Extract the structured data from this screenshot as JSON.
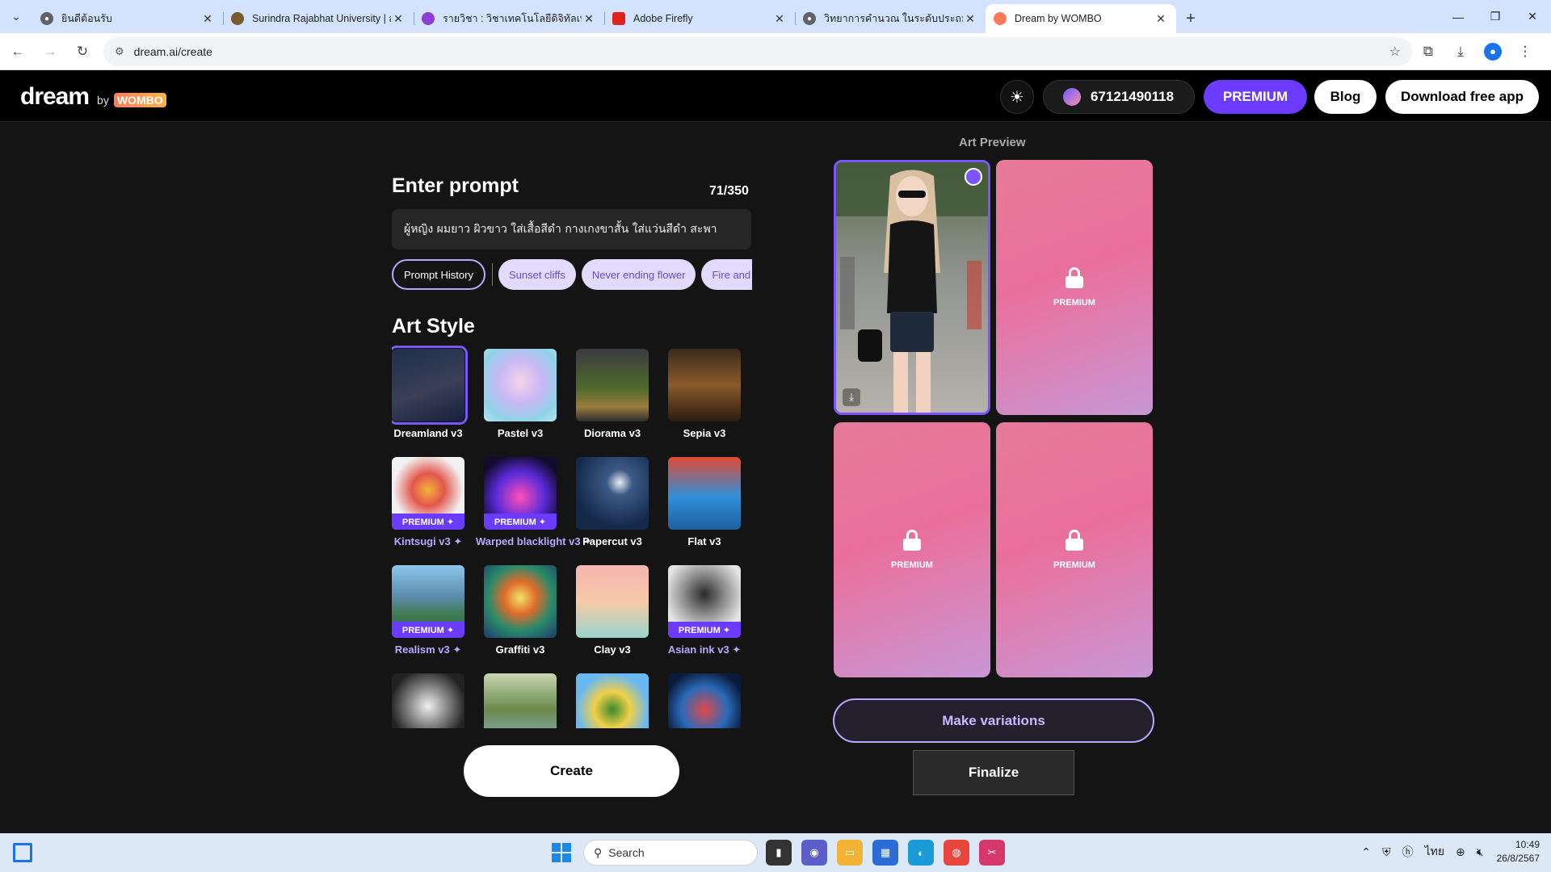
{
  "browser": {
    "tabs": [
      {
        "title": "ยินดีต้อนรับ",
        "fav_color": "#5f6368"
      },
      {
        "title": "Surindra Rajabhat University | ส",
        "fav_color": "#7a5a2a"
      },
      {
        "title": "รายวิชา : วิชาเทคโนโลยีดิจิทัลเพื่อการ",
        "fav_color": "#8e3dd6"
      },
      {
        "title": "Adobe Firefly",
        "fav_color": "#e0231d"
      },
      {
        "title": "วิทยาการคำนวณ ในระดับประถมศึกษ",
        "fav_color": "#5f6368"
      },
      {
        "title": "Dream by WOMBO",
        "fav_color": "#ff7a59"
      }
    ],
    "url": "dream.ai/create"
  },
  "header": {
    "logo_main": "dream",
    "logo_by": "by",
    "logo_brand": "WOMBO",
    "user_id": "67121490118",
    "premium_label": "PREMIUM",
    "blog_label": "Blog",
    "download_label": "Download free app"
  },
  "prompt": {
    "heading": "Enter prompt",
    "count": "71/350",
    "value": "ผู้หญิง ผมยาว ผิวขาว ใส่เสื้อสีดำ กางเกงขาสั้น ใส่แว่นสีดำ สะพา",
    "history_label": "Prompt History",
    "suggestions": [
      "Sunset cliffs",
      "Never ending flower",
      "Fire and w"
    ]
  },
  "art_style": {
    "heading": "Art Style",
    "premium_badge": "PREMIUM ✦",
    "styles": [
      {
        "name": "Dreamland v3",
        "premium": false,
        "selected": true,
        "bg": "linear-gradient(160deg,#1c2f4a,#3b3f58 55%,#15203a)"
      },
      {
        "name": "Pastel v3",
        "premium": false,
        "selected": false,
        "bg": "radial-gradient(circle at 50% 45%,#f7d3ea 0%,#c9b8f4 40%,#8fd3e8 75%,#b6e4ee)"
      },
      {
        "name": "Diorama v3",
        "premium": false,
        "selected": false,
        "bg": "linear-gradient(180deg,#3a3a42 0%,#4f6a2a 55%,#9a7b3d 80%,#2c2c30)"
      },
      {
        "name": "Sepia v3",
        "premium": false,
        "selected": false,
        "bg": "linear-gradient(180deg,#3a2a1c,#8a5a2a 50%,#2a1b10)"
      },
      {
        "name": "Kintsugi v3 ✦",
        "premium": true,
        "selected": false,
        "bg": "radial-gradient(circle at 50% 45%,#f5b33a 0%,#e2574c 30%,#f1f1f1 65%)"
      },
      {
        "name": "Warped blacklight v3 ✦",
        "premium": true,
        "selected": false,
        "bg": "radial-gradient(circle at 50% 55%,#ff4fb7 0%,#5b2bd9 45%,#120b2e 80%)"
      },
      {
        "name": "Papercut v3",
        "premium": false,
        "selected": false,
        "bg": "radial-gradient(circle at 60% 35%,#e8edf3 0%,#3c5a86 20%,#14284a 70%)"
      },
      {
        "name": "Flat v3",
        "premium": false,
        "selected": false,
        "bg": "linear-gradient(180deg,#e24a35,#2f8fd8 55%,#1f5fa0)"
      },
      {
        "name": "Realism v3 ✦",
        "premium": true,
        "selected": false,
        "bg": "linear-gradient(180deg,#8cc6ee 0%,#5a8aa8 45%,#3d7a4a 70%,#2a5a8a)"
      },
      {
        "name": "Graffiti v3",
        "premium": false,
        "selected": false,
        "bg": "radial-gradient(circle at 50% 45%,#f3e36a 0%,#e06b2a 30%,#2a8a6a 60%,#1c3a6a)"
      },
      {
        "name": "Clay v3",
        "premium": false,
        "selected": false,
        "bg": "linear-gradient(180deg,#f4b6b0,#f7c9a8 50%,#9ad4c9)"
      },
      {
        "name": "Asian ink v3 ✦",
        "premium": true,
        "selected": false,
        "bg": "radial-gradient(circle at 50% 40%,#2a2a2a 0%,#8a8a8a 35%,#e4e4e4 70%)"
      },
      {
        "name": "",
        "premium": false,
        "selected": false,
        "bg": "radial-gradient(circle at 50% 45%,#f0f0f0 0%,#888 35%,#222 70%)"
      },
      {
        "name": "",
        "premium": false,
        "selected": false,
        "bg": "linear-gradient(180deg,#c7d6b0,#6a8a4a 50%,#8ab0c8)"
      },
      {
        "name": "",
        "premium": false,
        "selected": false,
        "bg": "radial-gradient(circle at 50% 50%,#3c8a2a 0%,#f0d04a 35%,#6ab8f0 70%)"
      },
      {
        "name": "",
        "premium": false,
        "selected": false,
        "bg": "radial-gradient(circle at 50% 50%,#e04a4a 0%,#2a6ab8 45%,#0a1a3a 80%)"
      }
    ]
  },
  "create_label": "Create",
  "preview": {
    "heading": "Art Preview",
    "locked_label": "PREMIUM",
    "download_glyph": "⤓",
    "variations_label": "Make variations",
    "finalize_label": "Finalize"
  },
  "taskbar": {
    "search_label": "Search",
    "lang": "ไทย",
    "time": "10:49",
    "date": "26/8/2567"
  },
  "colors": {
    "accent": "#6b3cff",
    "accent_light": "#b9a8ff",
    "background": "#141414"
  }
}
